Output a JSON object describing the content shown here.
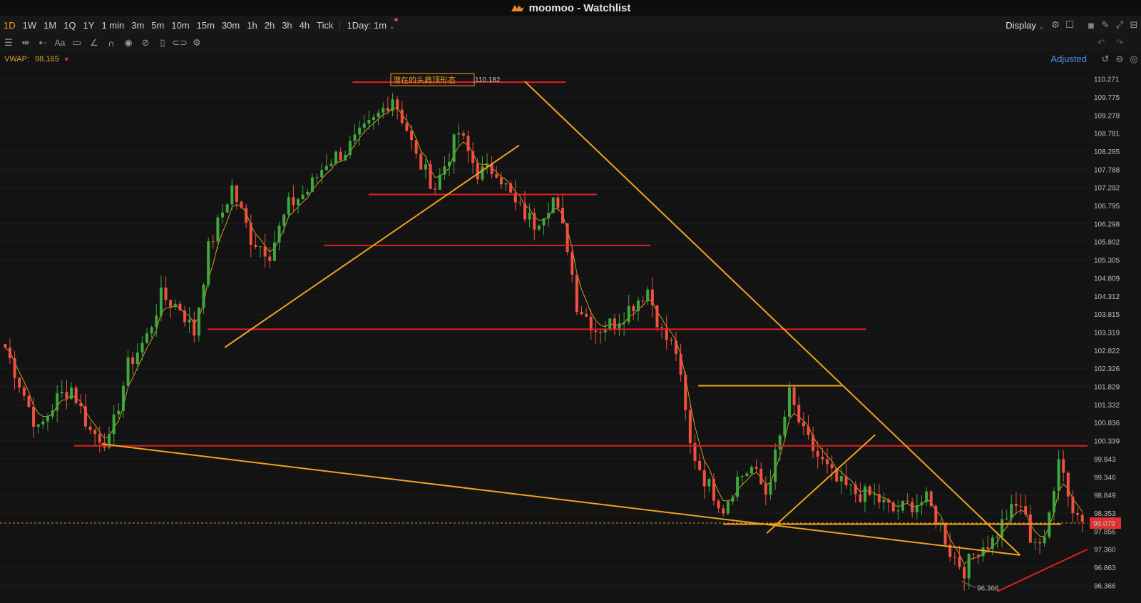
{
  "window": {
    "app_name": "moomoo",
    "title": "moomoo - Watchlist"
  },
  "toolbar": {
    "timeframes": [
      "1D",
      "1W",
      "1M",
      "1Q",
      "1Y",
      "1 min",
      "3m",
      "5m",
      "10m",
      "15m",
      "30m",
      "1h",
      "2h",
      "3h",
      "4h",
      "Tick"
    ],
    "active_timeframe": "1D",
    "range_select": "1Day: 1m",
    "display_label": "Display",
    "accent_color": "#f0a020"
  },
  "drawing_tools": [
    "menu-icon",
    "measure-icon",
    "arrow-left-icon",
    "text-icon",
    "comment-icon",
    "pen-icon",
    "magnet-icon",
    "eye-icon",
    "hide-icon",
    "trash-icon",
    "link-icon",
    "settings-icon"
  ],
  "indicator": {
    "label": "VWAP:",
    "value": "98.165"
  },
  "adjusted_label": "Adjusted",
  "chart_data": {
    "type": "candlestick",
    "ylim": [
      96.1,
      110.4
    ],
    "price_ticks": [
      "110.271",
      "109.775",
      "109.278",
      "108.781",
      "108.285",
      "107.788",
      "107.292",
      "106.795",
      "106.298",
      "105.802",
      "105.305",
      "104.809",
      "104.312",
      "103.815",
      "103.319",
      "102.822",
      "102.326",
      "101.829",
      "101.332",
      "100.836",
      "100.339",
      "99.843",
      "99.346",
      "98.849",
      "98.353",
      "97.856",
      "97.360",
      "96.863",
      "96.366"
    ],
    "current_price": "98.079",
    "high_label": "110.182",
    "low_label": "96.366",
    "pattern_annotation": "潜在的头肩顶形态",
    "up_color": "#3ea83e",
    "down_color": "#f05040",
    "vwap_color": "#c8a020",
    "anchors": [
      [
        0,
        102.9
      ],
      [
        4,
        101.6
      ],
      [
        7,
        100.6
      ],
      [
        11,
        101.5
      ],
      [
        14,
        101.8
      ],
      [
        18,
        100.6
      ],
      [
        22,
        100.3
      ],
      [
        26,
        102.4
      ],
      [
        30,
        103.2
      ],
      [
        33,
        104.3
      ],
      [
        37,
        104.0
      ],
      [
        40,
        103.3
      ],
      [
        43,
        105.6
      ],
      [
        48,
        107.3
      ],
      [
        52,
        105.9
      ],
      [
        56,
        105.5
      ],
      [
        60,
        106.8
      ],
      [
        64,
        107.2
      ],
      [
        68,
        108.0
      ],
      [
        72,
        108.3
      ],
      [
        78,
        109.1
      ],
      [
        82,
        109.8
      ],
      [
        85,
        108.9
      ],
      [
        87,
        108.1
      ],
      [
        91,
        107.3
      ],
      [
        96,
        108.8
      ],
      [
        100,
        107.7
      ],
      [
        104,
        107.8
      ],
      [
        108,
        106.8
      ],
      [
        112,
        106.3
      ],
      [
        116,
        107.0
      ],
      [
        119,
        105.7
      ],
      [
        121,
        104.1
      ],
      [
        125,
        103.4
      ],
      [
        129,
        103.6
      ],
      [
        133,
        104.1
      ],
      [
        136,
        104.5
      ],
      [
        139,
        103.3
      ],
      [
        142,
        102.8
      ],
      [
        145,
        100.2
      ],
      [
        148,
        99.3
      ],
      [
        152,
        98.5
      ],
      [
        155,
        99.3
      ],
      [
        158,
        99.6
      ],
      [
        161,
        98.9
      ],
      [
        164,
        100.4
      ],
      [
        166,
        101.6
      ],
      [
        169,
        100.5
      ],
      [
        172,
        99.9
      ],
      [
        176,
        99.2
      ],
      [
        180,
        98.9
      ],
      [
        184,
        98.8
      ],
      [
        188,
        98.4
      ],
      [
        192,
        98.6
      ],
      [
        195,
        98.7
      ],
      [
        198,
        98.0
      ],
      [
        200,
        97.3
      ],
      [
        203,
        96.8
      ],
      [
        206,
        97.4
      ],
      [
        209,
        97.6
      ],
      [
        212,
        98.3
      ],
      [
        215,
        98.6
      ],
      [
        217,
        97.7
      ],
      [
        220,
        97.5
      ],
      [
        223,
        100.0
      ],
      [
        226,
        98.4
      ],
      [
        228,
        98.2
      ]
    ],
    "horizontal_lines": [
      {
        "price": 110.182,
        "x0": 0.309,
        "x1": 0.496,
        "color": "#e02020"
      },
      {
        "price": 107.1,
        "x0": 0.323,
        "x1": 0.523,
        "color": "#e02020"
      },
      {
        "price": 105.7,
        "x0": 0.284,
        "x1": 0.57,
        "color": "#e02020"
      },
      {
        "price": 103.4,
        "x0": 0.182,
        "x1": 0.759,
        "color": "#e02020"
      },
      {
        "price": 100.2,
        "x0": 0.065,
        "x1": 0.97,
        "color": "#e02020"
      },
      {
        "price": 101.85,
        "x0": 0.612,
        "x1": 0.738,
        "color": "#f0a020"
      },
      {
        "price": 98.05,
        "x0": 0.634,
        "x1": 0.93,
        "color": "#f0a020"
      }
    ],
    "trend_lines": [
      {
        "p0": [
          0.197,
          102.9
        ],
        "p1": [
          0.455,
          108.45
        ],
        "color": "#f0a020"
      },
      {
        "p0": [
          0.46,
          110.2
        ],
        "p1": [
          0.894,
          97.2
        ],
        "color": "#f0a020"
      },
      {
        "p0": [
          0.089,
          100.25
        ],
        "p1": [
          0.894,
          97.2
        ],
        "color": "#f0a020"
      },
      {
        "p0": [
          0.672,
          97.8
        ],
        "p1": [
          0.767,
          100.5
        ],
        "color": "#f0a020"
      },
      {
        "p0": [
          0.874,
          96.2
        ],
        "p1": [
          0.99,
          97.9
        ],
        "color": "#e02020"
      }
    ]
  }
}
